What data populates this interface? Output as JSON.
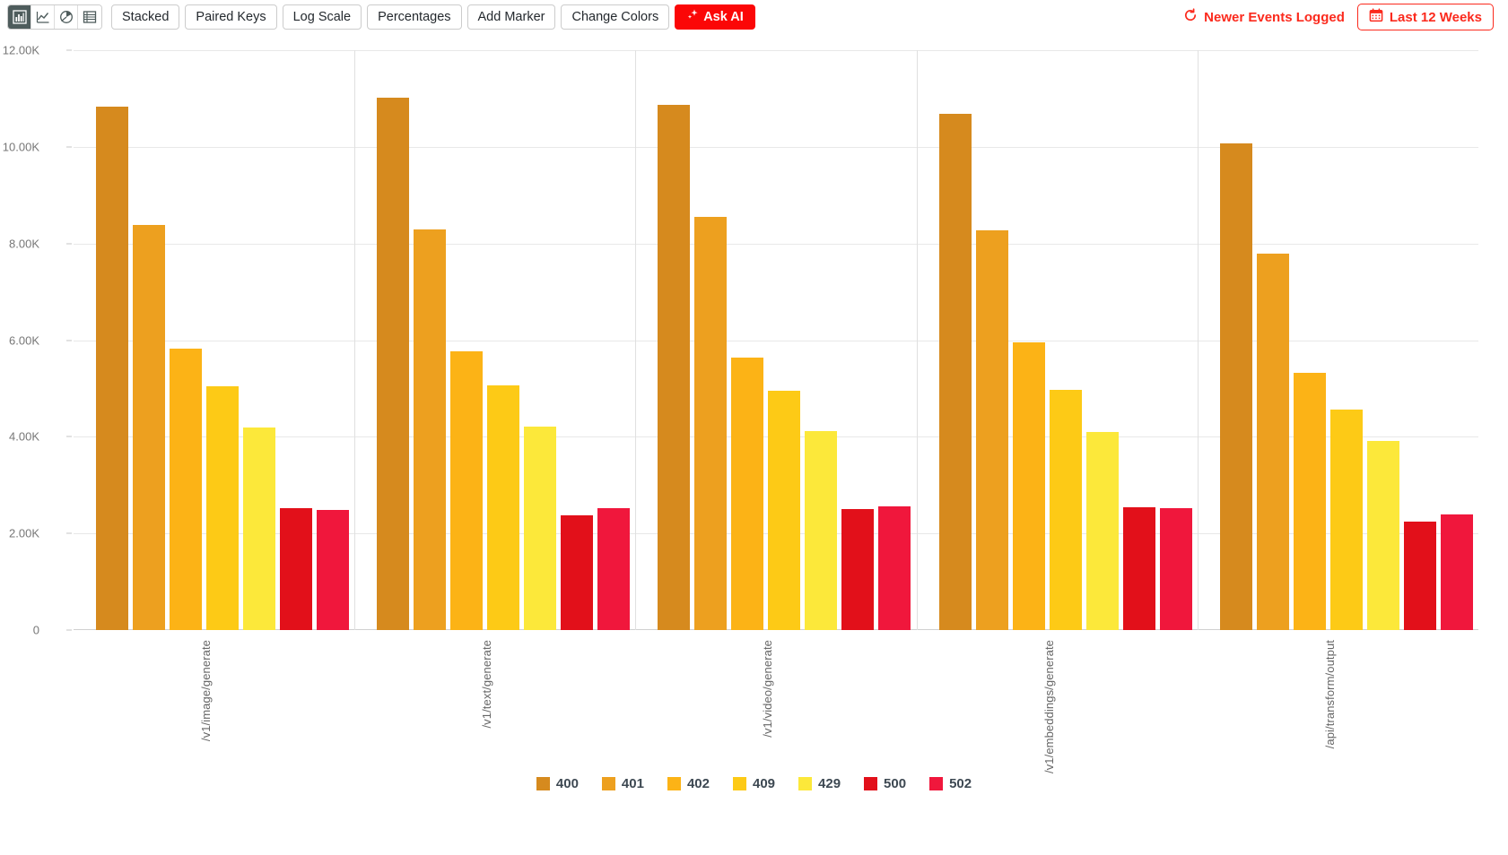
{
  "toolbar": {
    "chart_type_icons": [
      {
        "name": "bar-chart-icon",
        "label": "Bar chart",
        "active": true
      },
      {
        "name": "line-chart-icon",
        "label": "Line chart",
        "active": false
      },
      {
        "name": "pie-chart-icon",
        "label": "Pie chart",
        "active": false
      },
      {
        "name": "table-icon",
        "label": "Table",
        "active": false
      }
    ],
    "buttons": [
      {
        "label": "Stacked"
      },
      {
        "label": "Paired Keys"
      },
      {
        "label": "Log Scale"
      },
      {
        "label": "Percentages"
      },
      {
        "label": "Add Marker"
      },
      {
        "label": "Change Colors"
      }
    ],
    "ask_ai_label": "Ask AI",
    "ask_ai_color": "#fb0707",
    "refresh_label": "Newer Events Logged",
    "date_range_label": "Last 12 Weeks",
    "accent_color": "#fb2a1d"
  },
  "chart_data": {
    "type": "bar",
    "title": "",
    "xlabel": "",
    "ylabel": "",
    "ylim": [
      0,
      12000
    ],
    "grid": true,
    "legend_position": "bottom",
    "yticks": [
      "0",
      "2.00K",
      "4.00K",
      "6.00K",
      "8.00K",
      "10.00K",
      "12.00K"
    ],
    "ytick_values": [
      0,
      2000,
      4000,
      6000,
      8000,
      10000,
      12000
    ],
    "categories": [
      "/v1/image/generate",
      "/v1/text/generate",
      "/v1/video/generate",
      "/v1/embeddings/generate",
      "/api/transform/output"
    ],
    "series": [
      {
        "name": "400",
        "color": "#d68a1e",
        "values": [
          10830,
          11020,
          10860,
          10680,
          10070
        ]
      },
      {
        "name": "401",
        "color": "#eda01f",
        "values": [
          8380,
          8290,
          8550,
          8270,
          7790
        ]
      },
      {
        "name": "402",
        "color": "#fcb316",
        "values": [
          5830,
          5760,
          5640,
          5960,
          5330
        ]
      },
      {
        "name": "409",
        "color": "#fdca16",
        "values": [
          5040,
          5070,
          4950,
          4970,
          4570
        ]
      },
      {
        "name": "429",
        "color": "#fce83a",
        "values": [
          4200,
          4210,
          4110,
          4100,
          3910
        ]
      },
      {
        "name": "500",
        "color": "#e2101a",
        "values": [
          2520,
          2380,
          2510,
          2540,
          2240
        ]
      },
      {
        "name": "502",
        "color": "#f0173c",
        "values": [
          2480,
          2520,
          2560,
          2530,
          2390
        ]
      }
    ]
  }
}
